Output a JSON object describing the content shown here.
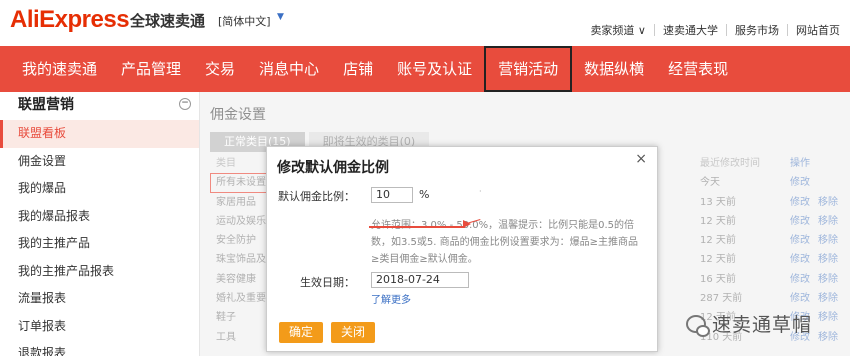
{
  "header": {
    "logo": "AliExpress",
    "logo_sub": "全球速卖通",
    "language": "[简体中文]",
    "links": [
      "卖家频道 ∨",
      "速卖通大学",
      "服务市场",
      "网站首页"
    ]
  },
  "nav": {
    "items": [
      "我的速卖通",
      "产品管理",
      "交易",
      "消息中心",
      "店铺",
      "账号及认证",
      "营销活动",
      "数据纵横",
      "经营表现"
    ],
    "active_index": 6
  },
  "sidebar": {
    "title": "联盟营销",
    "items": [
      "联盟看板",
      "佣金设置",
      "我的爆品",
      "我的爆品报表",
      "我的主推产品",
      "我的主推产品报表",
      "流量报表",
      "订单报表",
      "退款报表"
    ],
    "active_index": 0
  },
  "main": {
    "title": "佣金设置",
    "tabs": [
      "正常类目(15)",
      "即将生效的类目(0)"
    ],
    "table": {
      "headers": [
        "类目",
        "最近修改时间",
        "操作"
      ],
      "rows": [
        {
          "cat": "所有未设置",
          "time": "今天",
          "actions": [
            "修改"
          ]
        },
        {
          "cat": "家居用品",
          "time": "13 天前",
          "actions": [
            "修改",
            "移除"
          ]
        },
        {
          "cat": "运动及娱乐",
          "time": "12 天前",
          "actions": [
            "修改",
            "移除"
          ]
        },
        {
          "cat": "安全防护",
          "time": "12 天前",
          "actions": [
            "修改",
            "移除"
          ]
        },
        {
          "cat": "珠宝饰品及配",
          "time": "12 天前",
          "actions": [
            "修改",
            "移除"
          ]
        },
        {
          "cat": "美容健康",
          "time": "16 天前",
          "actions": [
            "修改",
            "移除"
          ]
        },
        {
          "cat": "婚礼及重要场",
          "time": "287 天前",
          "actions": [
            "修改",
            "移除"
          ]
        },
        {
          "cat": "鞋子",
          "time": "12 天前",
          "actions": [
            "修改",
            "移除"
          ]
        },
        {
          "cat": "工具",
          "time": "110 天前",
          "actions": [
            "修改",
            "移除"
          ]
        }
      ]
    }
  },
  "modal": {
    "title": "修改默认佣金比例",
    "close": "×",
    "rate_label": "默认佣金比例：",
    "rate_value": "10",
    "rate_unit": "%",
    "hint": "允许范围：3.0% - 50.0%，温馨提示：比例只能是0.5的倍数，如3.5或5. 商品的佣金比例设置要求为：爆品≥主推商品≥类目佣金≥默认佣金。",
    "date_label": "生效日期：",
    "date_value": "2018-07-24",
    "learn_more": "了解更多",
    "ok": "确定",
    "close_btn": "关闭"
  },
  "watermark": "速卖通草帽",
  "colors": {
    "accent": "#e84c3d",
    "button": "#f39b1a",
    "link": "#3a6fc4"
  }
}
